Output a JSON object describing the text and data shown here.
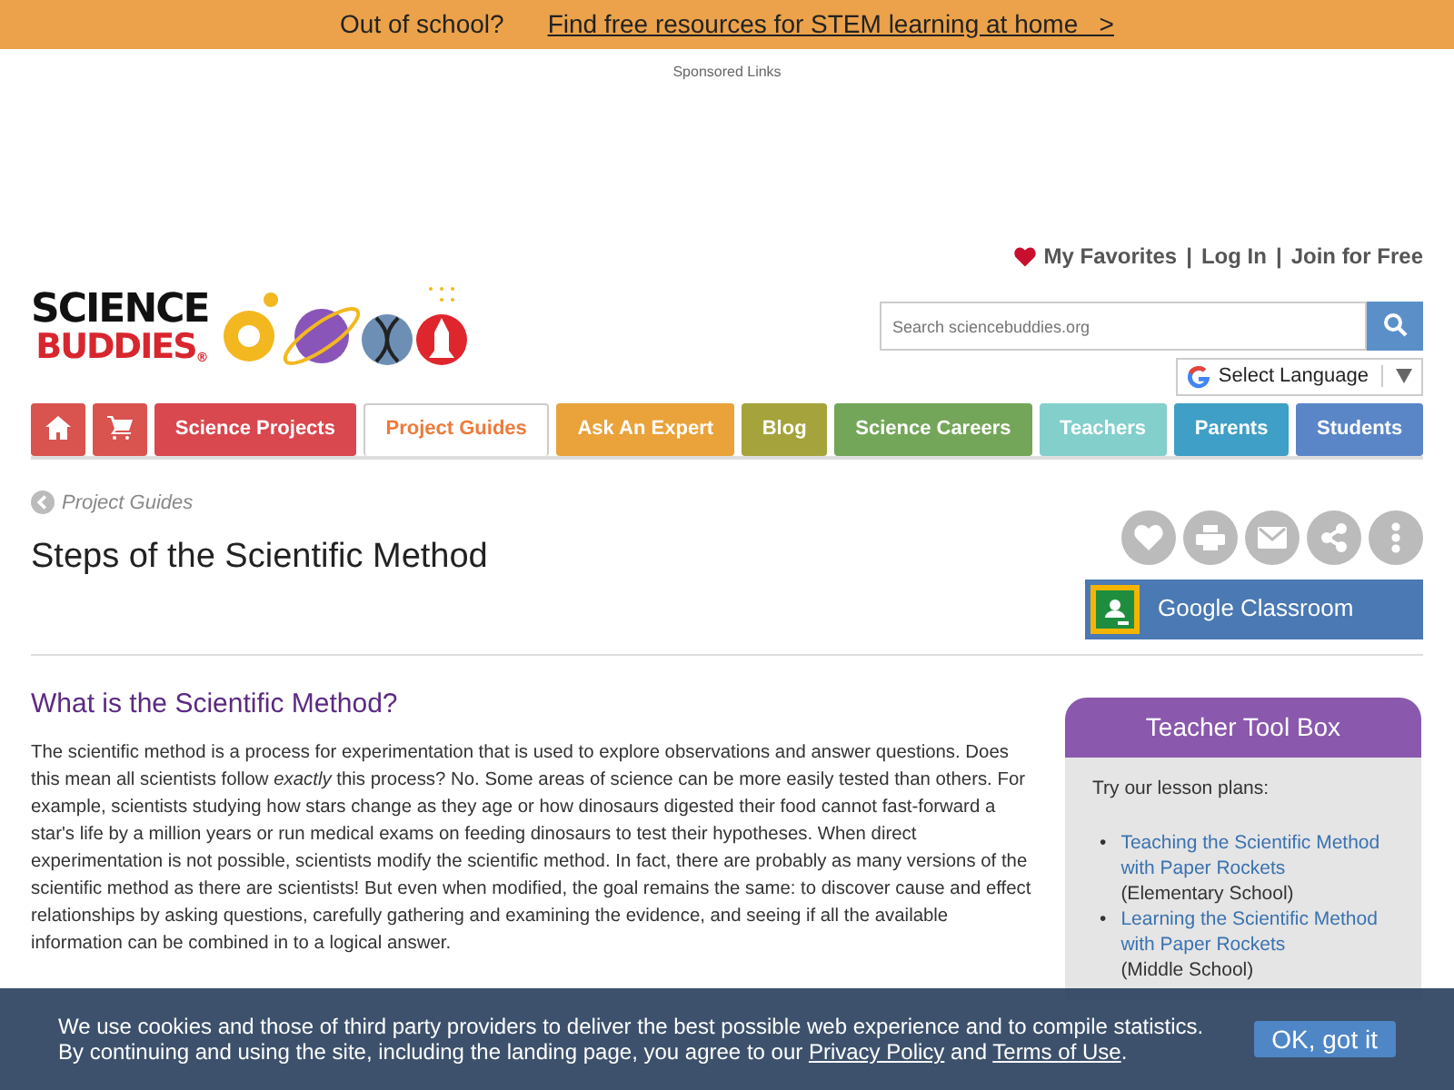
{
  "promo_bar": {
    "text": "Out of school?",
    "link": "Find free resources for STEM learning at home   >"
  },
  "sponsored": "Sponsored Links",
  "header": {
    "logo_top": "SCIENCE",
    "logo_bottom": "BUDDIES",
    "logo_mark": "®",
    "separator": "|",
    "account_links": [
      {
        "label": "My Favorites",
        "kind": "favorites"
      },
      {
        "label": "Log In",
        "kind": "plain"
      },
      {
        "label": "Join for Free",
        "kind": "plain"
      }
    ],
    "search": {
      "placeholder": "Search sciencebuddies.org"
    },
    "language": "Select Language"
  },
  "nav": [
    {
      "kind": "home",
      "selected": false,
      "color": "#d9534f"
    },
    {
      "kind": "cart",
      "selected": false,
      "color": "#d9534f"
    },
    {
      "kind": "text",
      "label": "Science Projects",
      "selected": false,
      "color": "#d9474f"
    },
    {
      "kind": "text",
      "label": "Project Guides",
      "selected": true,
      "color": "#ee7a3b"
    },
    {
      "kind": "text",
      "label": "Ask An Expert",
      "selected": false,
      "color": "#eaa23a"
    },
    {
      "kind": "text",
      "label": "Blog",
      "selected": false,
      "color": "#a5a33b"
    },
    {
      "kind": "text",
      "label": "Science Careers",
      "selected": false,
      "color": "#74a65a"
    },
    {
      "kind": "text",
      "label": "Teachers",
      "selected": false,
      "color": "#82cfcc"
    },
    {
      "kind": "text",
      "label": "Parents",
      "selected": false,
      "color": "#3f9fc6"
    },
    {
      "kind": "text",
      "label": "Students",
      "selected": false,
      "color": "#5a86c8"
    }
  ],
  "breadcrumb": "Project Guides",
  "title": "Steps of the Scientific Method",
  "actions": [
    {
      "kind": "favorite"
    },
    {
      "kind": "print"
    },
    {
      "kind": "email"
    },
    {
      "kind": "share"
    },
    {
      "kind": "more"
    }
  ],
  "classroom_button": "Google Classroom",
  "section_heading": "What is the Scientific Method?",
  "paragraph": "The scientific method is a process for experimentation that is used to explore observations and answer questions. Does this mean all scientists follow *exactly* this process? No. Some areas of science can be more easily tested than others. For example, scientists studying how stars change as they age or how dinosaurs digested their food cannot fast-forward a star's life by a million years or run medical exams on feeding dinosaurs to test their hypotheses. When direct experimentation is not possible, scientists modify the scientific method. In fact, there are probably as many versions of the scientific method as there are scientists! But even when modified, the goal remains the same: to discover cause and effect relationships by asking questions, carefully gathering and examining the evidence, and seeing if all the available information can be combined in to a logical answer.",
  "toolbox": {
    "title": "Teacher Tool Box",
    "intro": "Try our lesson plans:",
    "items": [
      {
        "bullet": "•",
        "link": "Teaching the Scientific Method with Paper Rockets",
        "note": "(Elementary School)"
      },
      {
        "bullet": "•",
        "link": "Learning the Scientific Method with Paper Rockets",
        "note": "(Middle School)"
      }
    ]
  },
  "cookie_banner": {
    "line1": "We use cookies and those of third party providers to deliver the best possible web experience and to compile statistics.",
    "line2_start": "By continuing and using the site, including the landing page, you agree to our",
    "privacy_link": "Privacy Policy",
    "and": "and",
    "terms_link": "Terms of Use",
    "end": ".",
    "button": "OK, got it"
  }
}
